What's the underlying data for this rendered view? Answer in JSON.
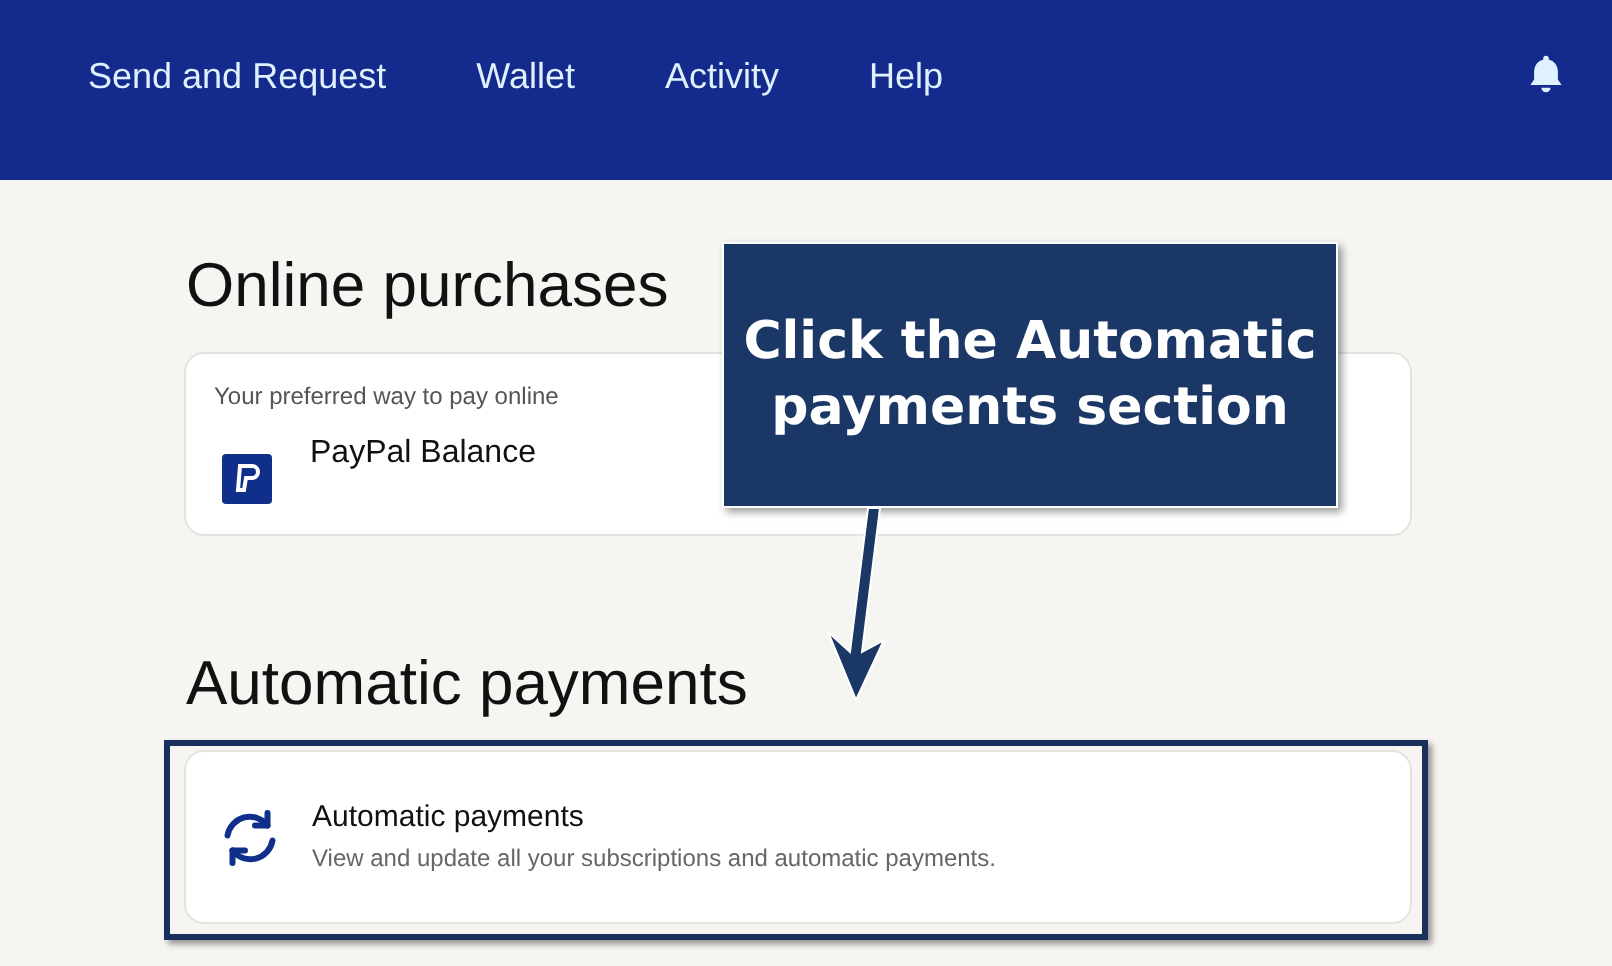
{
  "nav": {
    "items": [
      {
        "label": "Send and Request"
      },
      {
        "label": "Wallet"
      },
      {
        "label": "Activity"
      },
      {
        "label": "Help"
      }
    ]
  },
  "online_purchases": {
    "heading": "Online purchases",
    "card": {
      "caption": "Your preferred way to pay online",
      "method": "PayPal Balance"
    }
  },
  "automatic_payments": {
    "heading": "Automatic payments",
    "card": {
      "title": "Automatic payments",
      "description": "View and update all your subscriptions and automatic payments.",
      "highlighted": true
    }
  },
  "annotation": {
    "text": "Click the Automatic payments section"
  }
}
